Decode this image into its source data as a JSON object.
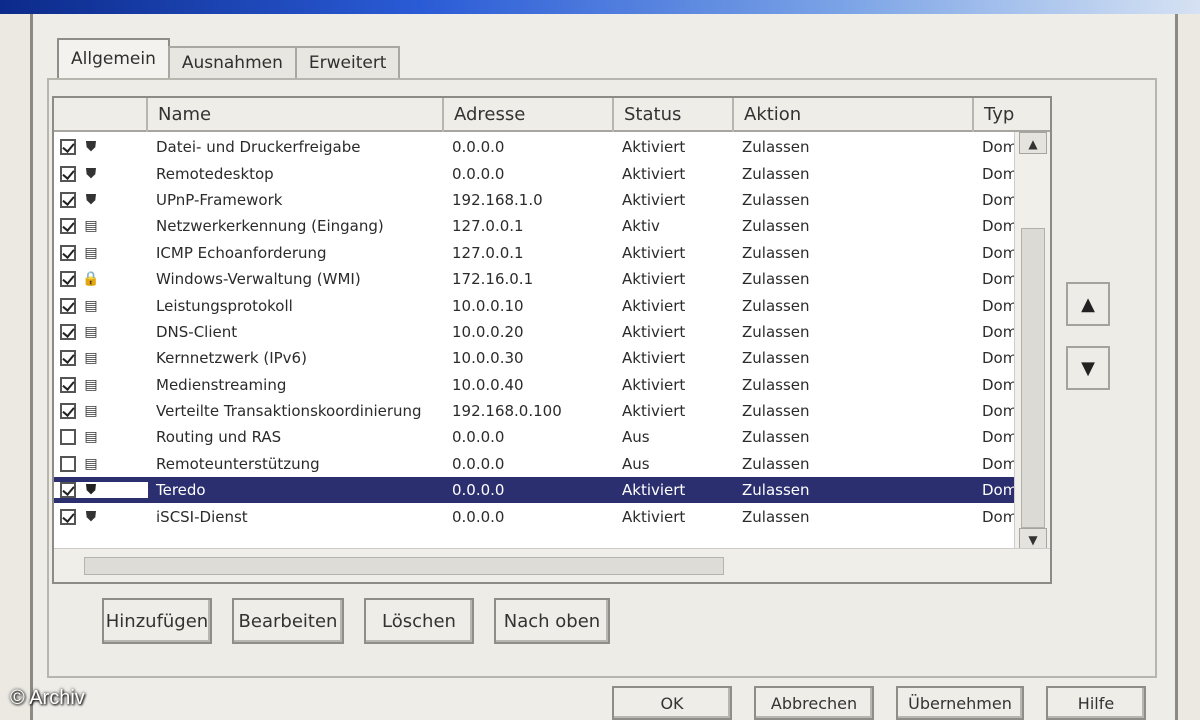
{
  "colors": {
    "selection": "#2b2f6f",
    "titlebar_start": "#0c2a8a",
    "titlebar_end": "#d6e2f3",
    "list_bg": "#ffffff"
  },
  "tabs": [
    {
      "label": "Allgemein"
    },
    {
      "label": "Ausnahmen"
    },
    {
      "label": "Erweitert"
    }
  ],
  "list": {
    "columns": [
      {
        "label": "Name"
      },
      {
        "label": "Adresse"
      },
      {
        "label": "Status"
      },
      {
        "label": "Aktion"
      },
      {
        "label": "Typ"
      }
    ],
    "rows": [
      {
        "checked": true,
        "icon": "shield-icon",
        "name": "Datei- und Druckerfreigabe",
        "address": "0.0.0.0",
        "status": "Aktiviert",
        "action": "Zulassen",
        "type": "Dom"
      },
      {
        "checked": true,
        "icon": "shield-icon",
        "name": "Remotedesktop",
        "address": "0.0.0.0",
        "status": "Aktiviert",
        "action": "Zulassen",
        "type": "Dom"
      },
      {
        "checked": true,
        "icon": "shield-icon",
        "name": "UPnP-Framework",
        "address": "192.168.1.0",
        "status": "Aktiviert",
        "action": "Zulassen",
        "type": "Dom"
      },
      {
        "checked": true,
        "icon": "app-icon",
        "name": "Netzwerkerkennung (Eingang)",
        "address": "127.0.0.1",
        "status": "Aktiv",
        "action": "Zulassen",
        "type": "Dom"
      },
      {
        "checked": true,
        "icon": "app-icon",
        "name": "ICMP Echoanforderung",
        "address": "127.0.0.1",
        "status": "Aktiviert",
        "action": "Zulassen",
        "type": "Dom"
      },
      {
        "checked": true,
        "icon": "lock-icon",
        "name": "Windows-Verwaltung (WMI)",
        "address": "172.16.0.1",
        "status": "Aktiviert",
        "action": "Zulassen",
        "type": "Dom"
      },
      {
        "checked": true,
        "icon": "app-icon",
        "name": "Leistungsprotokoll",
        "address": "10.0.0.10",
        "status": "Aktiviert",
        "action": "Zulassen",
        "type": "Dom"
      },
      {
        "checked": true,
        "icon": "app-icon",
        "name": "DNS-Client",
        "address": "10.0.0.20",
        "status": "Aktiviert",
        "action": "Zulassen",
        "type": "Dom"
      },
      {
        "checked": true,
        "icon": "app-icon",
        "name": "Kernnetzwerk (IPv6)",
        "address": "10.0.0.30",
        "status": "Aktiviert",
        "action": "Zulassen",
        "type": "Dom"
      },
      {
        "checked": true,
        "icon": "app-icon",
        "name": "Medienstreaming",
        "address": "10.0.0.40",
        "status": "Aktiviert",
        "action": "Zulassen",
        "type": "Dom"
      },
      {
        "checked": true,
        "icon": "app-icon",
        "name": "Verteilte Transaktionskoordinierung",
        "address": "192.168.0.100",
        "status": "Aktiviert",
        "action": "Zulassen",
        "type": "Dom"
      },
      {
        "checked": false,
        "icon": "app-icon",
        "name": "Routing und RAS",
        "address": "0.0.0.0",
        "status": "Aus",
        "action": "Zulassen",
        "type": "Dom"
      },
      {
        "checked": false,
        "icon": "app-icon",
        "name": "Remoteunterstützung",
        "address": "0.0.0.0",
        "status": "Aus",
        "action": "Zulassen",
        "type": "Dom"
      },
      {
        "checked": true,
        "icon": "shield-icon",
        "name": "Teredo",
        "address": "0.0.0.0",
        "status": "Aktiviert",
        "action": "Zulassen",
        "type": "Dom",
        "selected": true
      },
      {
        "checked": true,
        "icon": "shield-icon",
        "name": "iSCSI-Dienst",
        "address": "0.0.0.0",
        "status": "Aktiviert",
        "action": "Zulassen",
        "type": "Dom"
      }
    ]
  },
  "buttons": {
    "add": "Hinzufügen",
    "edit": "Bearbeiten",
    "delete": "Löschen",
    "move": "Nach oben"
  },
  "side_buttons": {
    "up": "▲",
    "down": "▼"
  },
  "footer": {
    "ok": "OK",
    "cancel": "Abbrechen",
    "apply": "Übernehmen",
    "help": "Hilfe"
  },
  "watermark": "© Archiv"
}
